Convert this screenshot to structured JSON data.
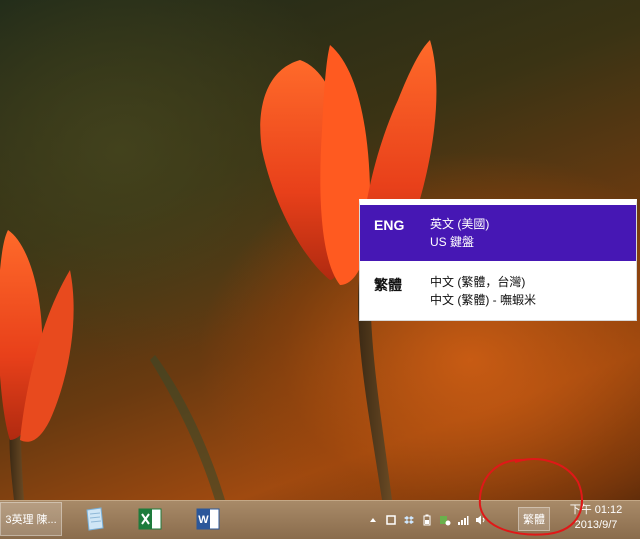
{
  "popup": {
    "items": [
      {
        "code": "ENG",
        "line1": "英文 (美國)",
        "line2": "US 鍵盤"
      },
      {
        "code": "繁體",
        "line1": "中文 (繁體，台灣)",
        "line2": "中文 (繁體) - 嘸蝦米"
      }
    ],
    "selected_color": "#4617b4"
  },
  "taskbar": {
    "open_window_title": "3英理 陳...",
    "apps": [
      {
        "name": "Notepad-like app",
        "icon": "notepad-icon"
      },
      {
        "name": "Excel",
        "icon": "excel-icon"
      },
      {
        "name": "Word",
        "icon": "word-icon"
      }
    ],
    "tray": {
      "icons": [
        "show-hidden-icons-chevron",
        "action-center-icon",
        "dropbox-icon",
        "battery-icon",
        "network-security-icon",
        "signal-icon",
        "volume-icon"
      ],
      "ime_indicator": "繁體"
    },
    "clock": {
      "time": "下午 01:12",
      "date": "2013/9/7"
    }
  }
}
